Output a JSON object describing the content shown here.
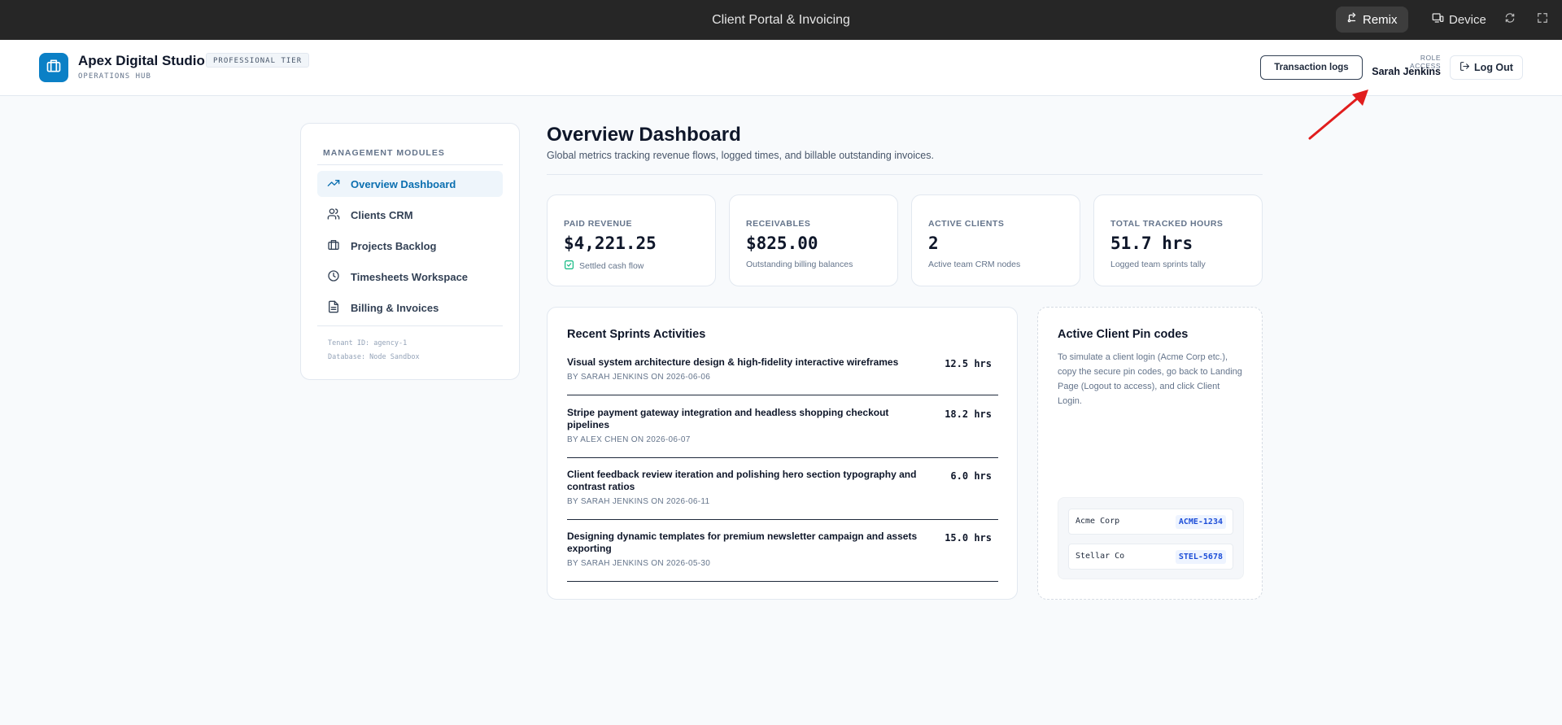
{
  "topbar": {
    "title": "Client Portal & Invoicing",
    "remix_label": "Remix",
    "device_label": "Device"
  },
  "header": {
    "brand_name": "Apex Digital Studio",
    "tier_badge": "PROFESSIONAL TIER",
    "subtitle": "OPERATIONS HUB",
    "transaction_logs_label": "Transaction logs",
    "role_label": "ROLE ACCESS",
    "role_user": "Sarah Jenkins",
    "logout_label": "Log Out"
  },
  "sidebar": {
    "heading": "MANAGEMENT MODULES",
    "items": [
      {
        "label": "Overview Dashboard",
        "icon": "trending-up-icon",
        "active": true
      },
      {
        "label": "Clients CRM",
        "icon": "users-icon",
        "active": false
      },
      {
        "label": "Projects Backlog",
        "icon": "briefcase-icon",
        "active": false
      },
      {
        "label": "Timesheets Workspace",
        "icon": "clock-icon",
        "active": false
      },
      {
        "label": "Billing & Invoices",
        "icon": "file-text-icon",
        "active": false
      }
    ],
    "tenant": "Tenant ID: agency-1",
    "database": "Database: Node Sandbox"
  },
  "main": {
    "title": "Overview Dashboard",
    "subtitle": "Global metrics tracking revenue flows, logged times, and billable outstanding invoices."
  },
  "stats": [
    {
      "label": "PAID REVENUE",
      "value": "$4,221.25",
      "note": "Settled cash flow",
      "has_check": true
    },
    {
      "label": "RECEIVABLES",
      "value": "$825.00",
      "note": "Outstanding billing balances",
      "has_check": false
    },
    {
      "label": "ACTIVE CLIENTS",
      "value": "2",
      "note": "Active team CRM nodes",
      "has_check": false
    },
    {
      "label": "TOTAL TRACKED HOURS",
      "value": "51.7 hrs",
      "note": "Logged team sprints tally",
      "has_check": false
    }
  ],
  "activities": {
    "title": "Recent Sprints Activities",
    "items": [
      {
        "desc": "Visual system architecture design & high-fidelity interactive wireframes",
        "meta": "BY SARAH JENKINS ON 2026-06-06",
        "hours": "12.5 hrs"
      },
      {
        "desc": "Stripe payment gateway integration and headless shopping checkout pipelines",
        "meta": "BY ALEX CHEN ON 2026-06-07",
        "hours": "18.2 hrs"
      },
      {
        "desc": "Client feedback review iteration and polishing hero section typography and contrast ratios",
        "meta": "BY SARAH JENKINS ON 2026-06-11",
        "hours": "6.0 hrs"
      },
      {
        "desc": "Designing dynamic templates for premium newsletter campaign and assets exporting",
        "meta": "BY SARAH JENKINS ON 2026-05-30",
        "hours": "15.0 hrs"
      }
    ]
  },
  "pins": {
    "title": "Active Client Pin codes",
    "description": "To simulate a client login (Acme Corp etc.), copy the secure pin codes, go back to Landing Page (Logout to access), and click Client Login.",
    "items": [
      {
        "client": "Acme Corp",
        "code": "ACME-1234"
      },
      {
        "client": "Stellar Co",
        "code": "STEL-5678"
      }
    ]
  },
  "colors": {
    "accent": "#0b80c6",
    "annotation_arrow": "#e11d1d"
  }
}
